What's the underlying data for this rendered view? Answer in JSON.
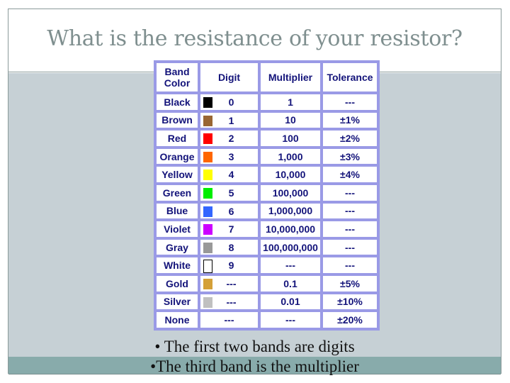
{
  "slide": {
    "title": "What is the resistance of your resistor?",
    "bullets": [
      "•  The first two bands are digits",
      "•The third band is the multiplier"
    ]
  },
  "table": {
    "headers": {
      "band_color_line1": "Band",
      "band_color_line2": "Color",
      "digit": "Digit",
      "multiplier": "Multiplier",
      "tolerance": "Tolerance"
    },
    "rows": [
      {
        "color": "Black",
        "swatch": "#000000",
        "digit": "0",
        "multiplier": "1",
        "tolerance": "---"
      },
      {
        "color": "Brown",
        "swatch": "#996633",
        "digit": "1",
        "multiplier": "10",
        "tolerance": "±1%"
      },
      {
        "color": "Red",
        "swatch": "#ff0000",
        "digit": "2",
        "multiplier": "100",
        "tolerance": "±2%"
      },
      {
        "color": "Orange",
        "swatch": "#ff6600",
        "digit": "3",
        "multiplier": "1,000",
        "tolerance": "±3%"
      },
      {
        "color": "Yellow",
        "swatch": "#ffff00",
        "digit": "4",
        "multiplier": "10,000",
        "tolerance": "±4%"
      },
      {
        "color": "Green",
        "swatch": "#00ee00",
        "digit": "5",
        "multiplier": "100,000",
        "tolerance": "---"
      },
      {
        "color": "Blue",
        "swatch": "#3366ff",
        "digit": "6",
        "multiplier": "1,000,000",
        "tolerance": "---"
      },
      {
        "color": "Violet",
        "swatch": "#cc00ff",
        "digit": "7",
        "multiplier": "10,000,000",
        "tolerance": "---"
      },
      {
        "color": "Gray",
        "swatch": "#999999",
        "digit": "8",
        "multiplier": "100,000,000",
        "tolerance": "---"
      },
      {
        "color": "White",
        "swatch": "#ffffff",
        "digit": "9",
        "multiplier": "---",
        "tolerance": "---"
      },
      {
        "color": "Gold",
        "swatch": "#d4a038",
        "digit": "---",
        "multiplier": "0.1",
        "tolerance": "±5%"
      },
      {
        "color": "Silver",
        "swatch": "#c0c0c0",
        "digit": "---",
        "multiplier": "0.01",
        "tolerance": "±10%"
      },
      {
        "color": "None",
        "swatch": null,
        "digit": "---",
        "multiplier": "---",
        "tolerance": "±20%"
      }
    ]
  }
}
